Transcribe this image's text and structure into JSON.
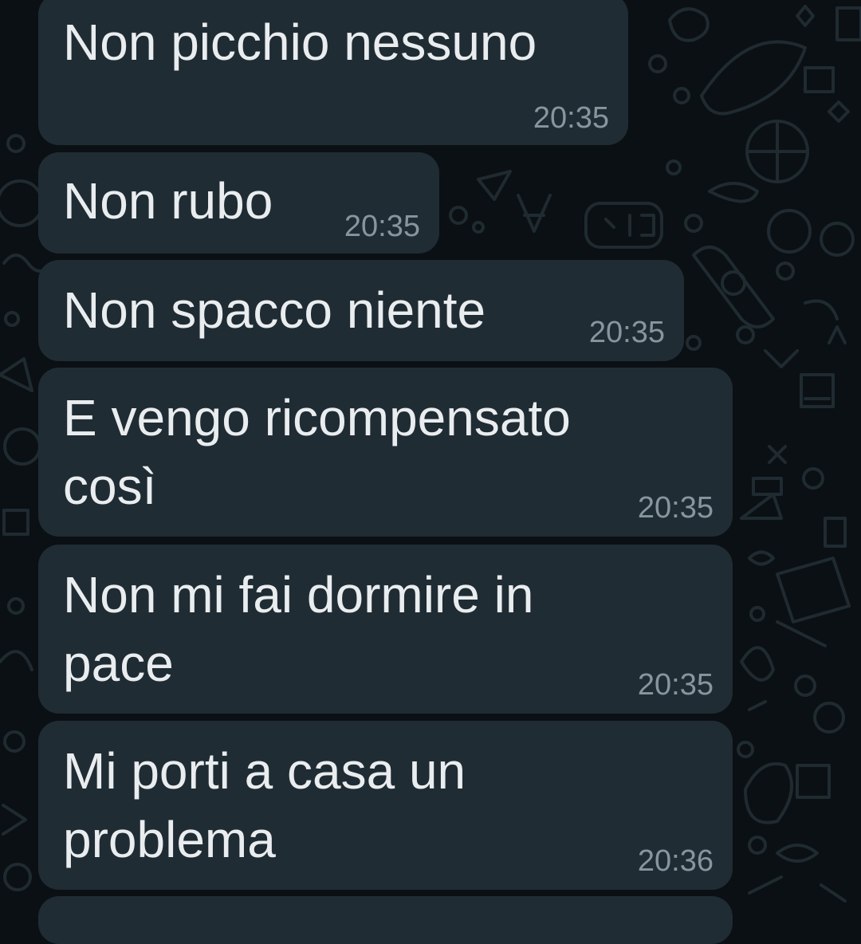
{
  "messages": [
    {
      "lines": [
        "Non picchio nessuno"
      ],
      "time": "20:35"
    },
    {
      "lines": [
        "Non rubo"
      ],
      "time": "20:35"
    },
    {
      "lines": [
        "Non spacco niente"
      ],
      "time": "20:35"
    },
    {
      "lines": [
        "E vengo ricompensato",
        "così"
      ],
      "time": "20:35"
    },
    {
      "lines": [
        "Non mi fai dormire in",
        "pace"
      ],
      "time": "20:35"
    },
    {
      "lines": [
        "Mi porti a casa un",
        "problema"
      ],
      "time": "20:36"
    }
  ],
  "colors": {
    "background": "#0b1014",
    "bubble": "#202c33",
    "text": "#e9edef",
    "timestamp": "#8696a0",
    "doodle": "#1e2a30"
  }
}
